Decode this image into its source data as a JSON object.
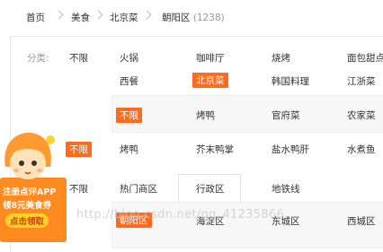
{
  "breadcrumb": {
    "items": [
      "首页",
      "美食",
      "北京菜",
      "朝阳区"
    ],
    "count": "(1238)"
  },
  "filter": {
    "category_label": "分类:",
    "unlimited": "不限",
    "categories_row1": [
      "火锅",
      "咖啡厅",
      "烧烤",
      "面包甜点"
    ],
    "categories_row2": [
      "西餐",
      "北京菜",
      "韩国料理",
      "江浙菜"
    ],
    "sub_row1": [
      "不限",
      "烤鸭",
      "官府菜",
      "农家菜"
    ],
    "sub_row2": [
      "不限",
      "烤鸭",
      "芥末鸭掌",
      "盐水鸭肝",
      "水煮鱼"
    ],
    "region_tabs": [
      "不限",
      "热门商区",
      "行政区",
      "地铁线"
    ],
    "districts": [
      "朝阳区",
      "海淀区",
      "东城区",
      "西城区"
    ]
  },
  "promo": {
    "line1": "注册点评APP",
    "line2": "领8元美食券",
    "button": "点击领取"
  },
  "watermark": "http://blog.csdn.net/qq_41235866",
  "colors": {
    "accent": "#ff6a1c",
    "promo_bg": "#ff8a1f",
    "promo_button": "#ffd12a"
  }
}
